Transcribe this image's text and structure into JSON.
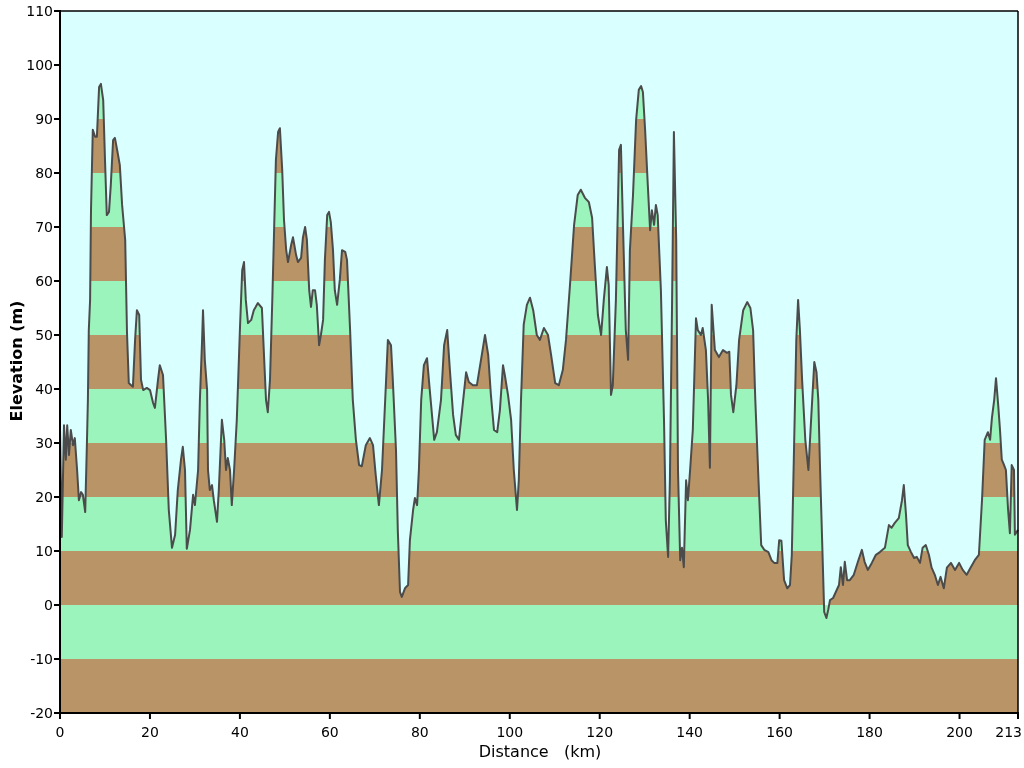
{
  "elevation_profile": {
    "chart_data": {
      "type": "area",
      "xlabel": "Distance   (km)",
      "ylabel": "Elevation (m)",
      "xlim": [
        0,
        213
      ],
      "ylim": [
        -20,
        110
      ],
      "xticks": [
        0,
        20,
        40,
        60,
        80,
        100,
        120,
        140,
        160,
        180,
        200,
        213
      ],
      "yticks": [
        -20,
        -10,
        0,
        10,
        20,
        30,
        40,
        50,
        60,
        70,
        80,
        90,
        100,
        110
      ],
      "x": [
        0,
        0.4,
        0.9,
        1.3,
        1.6,
        2.0,
        2.4,
        2.9,
        3.3,
        3.8,
        4.2,
        4.7,
        5.1,
        5.6,
        6.0,
        6.2,
        6.4,
        6.7,
        6.9,
        7.3,
        7.8,
        8.2,
        8.7,
        9.1,
        9.6,
        10.0,
        10.4,
        10.9,
        11.3,
        11.8,
        12.2,
        12.7,
        13.3,
        13.8,
        14.5,
        14.9,
        15.3,
        15.8,
        16.2,
        16.7,
        17.1,
        17.6,
        18.0,
        18.5,
        19.3,
        20.0,
        20.7,
        21.1,
        21.8,
        22.2,
        22.9,
        23.6,
        24.2,
        24.9,
        25.6,
        26.2,
        26.9,
        27.3,
        27.8,
        28.2,
        28.9,
        29.6,
        30.0,
        30.7,
        31.1,
        31.6,
        31.8,
        32.2,
        32.7,
        32.9,
        33.3,
        33.8,
        34.2,
        34.9,
        35.3,
        36.0,
        36.5,
        36.9,
        37.3,
        37.8,
        38.2,
        38.7,
        39.3,
        40.0,
        40.5,
        40.9,
        41.3,
        41.8,
        42.5,
        43.1,
        44.0,
        44.9,
        45.4,
        45.8,
        46.2,
        46.7,
        47.2,
        47.6,
        48.0,
        48.5,
        48.9,
        49.4,
        49.8,
        50.3,
        50.7,
        51.4,
        51.8,
        52.5,
        52.9,
        53.6,
        54.0,
        54.5,
        54.9,
        55.4,
        55.8,
        56.2,
        56.7,
        57.1,
        57.6,
        58.0,
        58.5,
        58.9,
        59.4,
        59.8,
        60.2,
        60.7,
        61.1,
        61.6,
        62.2,
        62.7,
        63.4,
        63.8,
        64.5,
        65.1,
        65.8,
        66.5,
        67.1,
        68.0,
        68.9,
        69.6,
        70.2,
        70.9,
        71.6,
        72.3,
        72.9,
        73.6,
        74.0,
        74.7,
        75.1,
        75.6,
        76.0,
        76.7,
        77.4,
        77.8,
        78.5,
        78.9,
        79.4,
        79.8,
        80.3,
        80.9,
        81.6,
        82.3,
        83.2,
        83.8,
        84.7,
        85.4,
        86.1,
        86.7,
        87.4,
        88.0,
        88.7,
        89.4,
        90.3,
        90.9,
        91.8,
        92.7,
        93.6,
        94.5,
        95.2,
        95.8,
        96.5,
        97.2,
        97.8,
        98.5,
        98.9,
        99.6,
        100.3,
        100.9,
        101.6,
        102.0,
        102.5,
        103.1,
        103.8,
        104.5,
        105.2,
        106.0,
        106.7,
        107.6,
        108.5,
        109.2,
        110.1,
        110.9,
        111.8,
        112.5,
        113.4,
        114.3,
        115.1,
        115.8,
        116.7,
        117.6,
        118.3,
        118.9,
        119.6,
        120.3,
        120.9,
        121.6,
        122.0,
        122.5,
        122.9,
        123.6,
        124.3,
        124.7,
        125.2,
        125.8,
        126.3,
        126.7,
        127.4,
        128.1,
        128.7,
        129.2,
        129.6,
        130.1,
        130.7,
        131.2,
        131.6,
        132.1,
        132.5,
        132.9,
        133.6,
        134.3,
        134.7,
        135.2,
        135.6,
        136.1,
        136.5,
        137.0,
        137.4,
        137.9,
        138.3,
        138.7,
        139.2,
        139.6,
        140.1,
        140.7,
        141.4,
        141.8,
        142.5,
        142.9,
        143.6,
        144.1,
        144.5,
        144.9,
        145.6,
        146.5,
        147.4,
        148.3,
        148.8,
        149.2,
        149.7,
        150.4,
        151.0,
        151.9,
        152.8,
        153.5,
        154.1,
        154.6,
        155.3,
        155.9,
        156.6,
        157.5,
        158.2,
        158.8,
        159.5,
        159.9,
        160.4,
        161.0,
        161.7,
        162.3,
        162.7,
        163.2,
        163.7,
        164.1,
        164.5,
        165.0,
        165.7,
        166.4,
        167.0,
        167.7,
        168.2,
        168.6,
        169.0,
        169.5,
        169.9,
        170.4,
        170.8,
        171.2,
        171.9,
        172.5,
        173.2,
        173.6,
        174.1,
        174.5,
        175.0,
        175.6,
        176.5,
        177.4,
        178.3,
        178.9,
        179.6,
        180.5,
        181.4,
        182.3,
        183.4,
        184.3,
        184.9,
        185.6,
        186.5,
        187.2,
        187.6,
        188.1,
        188.5,
        189.2,
        189.9,
        190.5,
        191.2,
        191.8,
        192.5,
        193.2,
        193.8,
        194.5,
        195.2,
        195.8,
        196.5,
        197.2,
        198.1,
        199.0,
        199.9,
        200.7,
        201.6,
        202.5,
        203.4,
        204.3,
        205.0,
        205.6,
        206.3,
        206.8,
        207.2,
        207.7,
        208.1,
        208.6,
        209.0,
        209.4,
        209.9,
        210.3,
        210.8,
        211.2,
        211.6,
        212.1,
        212.3,
        213.0
      ],
      "values": [
        32.4,
        12.6,
        33.3,
        26.9,
        33.3,
        27.8,
        32.4,
        29.6,
        30.9,
        25,
        19.4,
        20.9,
        20.4,
        17.2,
        30.6,
        38,
        50.9,
        56.5,
        73.1,
        88,
        86.7,
        86.7,
        95.9,
        96.5,
        93.5,
        82.4,
        72.2,
        72.8,
        77.8,
        86.1,
        86.5,
        84.3,
        81.5,
        74.1,
        67.6,
        50.4,
        41.1,
        40.7,
        40.4,
        49.1,
        54.6,
        53.7,
        41.7,
        39.8,
        40.2,
        39.8,
        37.4,
        36.5,
        41.7,
        44.4,
        42.6,
        30.6,
        17.6,
        10.6,
        13,
        21.3,
        26.9,
        29.3,
        25,
        10.4,
        13.9,
        20.4,
        18.5,
        25,
        38,
        49.1,
        54.6,
        45.4,
        39.8,
        25,
        21.3,
        22.2,
        19.4,
        15.4,
        21.3,
        34.3,
        30.6,
        25,
        27.2,
        25,
        18.5,
        25,
        34.3,
        50.9,
        62,
        63.5,
        56.5,
        52.2,
        52.8,
        54.6,
        55.9,
        55,
        45.4,
        38,
        35.7,
        41.7,
        56.5,
        69.4,
        82.4,
        87.6,
        88.3,
        80.6,
        71.3,
        65.7,
        63.5,
        66.7,
        68.1,
        64.8,
        63.5,
        64.3,
        68,
        70,
        67.6,
        58.3,
        55.2,
        58.3,
        58.3,
        55.6,
        48.1,
        50,
        52.8,
        63.9,
        72.2,
        72.8,
        70.9,
        65.7,
        58.3,
        55.6,
        60.2,
        65.7,
        65.4,
        63.9,
        50.9,
        38,
        30.6,
        25.9,
        25.7,
        29.6,
        30.9,
        29.6,
        24.1,
        18.5,
        25,
        38,
        49.1,
        48.1,
        41.7,
        28.7,
        13.9,
        2.4,
        1.5,
        3.1,
        3.7,
        12,
        17.6,
        19.8,
        18.5,
        25,
        38,
        44.4,
        45.7,
        38.9,
        30.6,
        32,
        38,
        48.1,
        50.9,
        43.5,
        35.2,
        31.5,
        30.6,
        36.1,
        43.1,
        41.3,
        40.7,
        40.7,
        45.4,
        50,
        46.3,
        38.9,
        32.4,
        32,
        36.1,
        44.4,
        42.6,
        38.9,
        34.3,
        25,
        17.6,
        23.1,
        38,
        51.9,
        55.6,
        56.9,
        54.6,
        50,
        49.1,
        51.3,
        50,
        46.3,
        41.1,
        40.7,
        43.5,
        49.1,
        59.3,
        70.4,
        75.9,
        76.9,
        75.4,
        74.6,
        71.7,
        63,
        53.7,
        50,
        56.5,
        62.6,
        59.3,
        38.9,
        40.7,
        56.5,
        84.3,
        85.2,
        69.4,
        50.9,
        45.4,
        65.7,
        75.9,
        89.8,
        95.4,
        96.1,
        95,
        88,
        77.8,
        69.4,
        73.1,
        70.4,
        74.1,
        72.2,
        58.3,
        34.3,
        15.7,
        8.9,
        23.1,
        56.5,
        87.6,
        67.6,
        25,
        8.3,
        10.6,
        7,
        23.1,
        19.4,
        25,
        32.4,
        53.1,
        50.9,
        50,
        51.3,
        47.2,
        38,
        25.4,
        55.6,
        47.2,
        45.9,
        47.2,
        46.7,
        46.9,
        38.9,
        35.7,
        40.7,
        49.1,
        54.6,
        56.1,
        55,
        50.9,
        38,
        23.1,
        11.1,
        10.2,
        9.8,
        8.3,
        7.8,
        7.8,
        12,
        11.9,
        4.6,
        3.1,
        3.7,
        9.3,
        28.7,
        49.1,
        56.5,
        50.9,
        41.7,
        30.6,
        25,
        34.3,
        45,
        43.1,
        38,
        25,
        10.2,
        -1.3,
        -2.4,
        -0.9,
        0.9,
        1.3,
        2.4,
        3.7,
        7,
        3.7,
        8,
        4.6,
        4.6,
        5.6,
        8,
        10.2,
        8,
        6.5,
        7.8,
        9.3,
        9.8,
        10.6,
        14.8,
        14.3,
        15.2,
        16.1,
        19.4,
        22.2,
        16.7,
        11.1,
        9.8,
        8.7,
        8.9,
        7.8,
        10.6,
        11.1,
        9.3,
        6.9,
        5.6,
        3.7,
        5.2,
        3.1,
        6.9,
        7.8,
        6.5,
        7.8,
        6.5,
        5.6,
        7,
        8.3,
        9.3,
        19.4,
        30.6,
        32,
        30.6,
        34.6,
        38,
        42,
        37,
        32.4,
        26.9,
        25.9,
        25,
        17.6,
        13.3,
        25.9,
        25,
        13,
        13.9
      ]
    }
  }
}
